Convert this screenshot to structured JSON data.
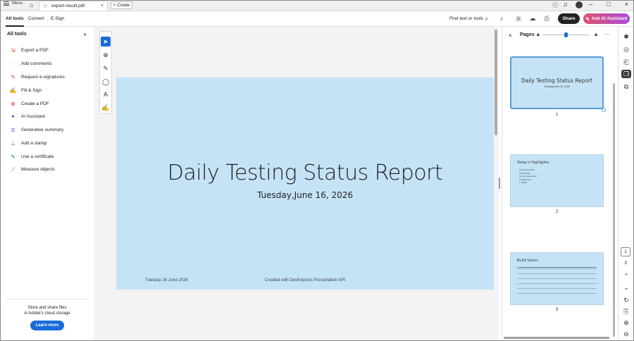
{
  "titlebar": {
    "menu_label": "Menu",
    "doc_tab": "export-result.pdf",
    "create_label": "Create"
  },
  "toolbar": {
    "tabs": [
      "All tools",
      "Convert",
      "E-Sign"
    ],
    "find_text": "Find text or tools",
    "share": "Share",
    "ask_ai": "Ask AI Assistant"
  },
  "left_panel": {
    "title": "All tools",
    "items": [
      {
        "label": "Export a PDF",
        "icon": "export-pdf-icon",
        "color": "#d4401f"
      },
      {
        "label": "Add comments",
        "icon": "comment-icon",
        "color": "#e0a800"
      },
      {
        "label": "Request e-signatures",
        "icon": "esign-icon",
        "color": "#c0398c"
      },
      {
        "label": "Fill & Sign",
        "icon": "fill-sign-icon",
        "color": "#7b3fbf"
      },
      {
        "label": "Create a PDF",
        "icon": "create-pdf-icon",
        "color": "#d4401f"
      },
      {
        "label": "AI Assistant",
        "icon": "ai-assistant-icon",
        "color": "#7b3fbf"
      },
      {
        "label": "Generative summary",
        "icon": "summary-icon",
        "color": "#3a5fc8"
      },
      {
        "label": "Add a stamp",
        "icon": "stamp-icon",
        "color": "#3a5fc8"
      },
      {
        "label": "Use a certificate",
        "icon": "certificate-icon",
        "color": "#1f8a7a"
      },
      {
        "label": "Measure objects",
        "icon": "measure-icon",
        "color": "#b0329c"
      }
    ],
    "store_text_1": "Store and share files",
    "store_text_2": "in Adobe's cloud storage",
    "learn_more": "Learn more"
  },
  "slide": {
    "title": "Daily Testing Status Report",
    "subtitle": "Tuesday,June 16, 2026",
    "footer_left": "Tuesday 16 June 2026",
    "footer_center": "Created with DevExpress Presentation API"
  },
  "pages_panel": {
    "title": "Pages",
    "thumbs": [
      {
        "number": "1",
        "title": "Daily Testing Status Report",
        "subtitle": "Tuesday,June 16, 2026"
      },
      {
        "number": "2",
        "title": "Today's Highlights",
        "bullets": [
          "5 successful builds",
          "2 failed builds",
          "12 new bugs reported",
          "8 deployments",
          "1 rollback"
        ]
      },
      {
        "number": "3",
        "title": "Build Status"
      }
    ]
  },
  "navigation": {
    "current_page": "1",
    "total_pages": "3"
  },
  "colors": {
    "slide_bg": "#c5e3f7",
    "accent": "#1a6bd8"
  }
}
